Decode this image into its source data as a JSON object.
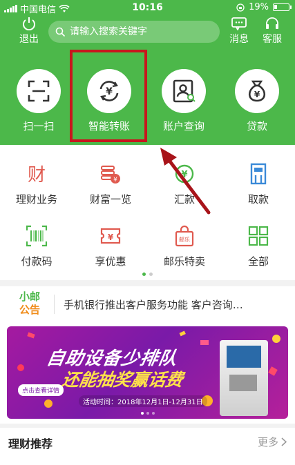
{
  "status_bar": {
    "carrier": "中国电信",
    "time": "10:16",
    "battery": "19%",
    "battery_level": 0.19
  },
  "header": {
    "logout_label": "退出",
    "search_placeholder": "请输入搜索关键字",
    "message_label": "消息",
    "service_label": "客服"
  },
  "quick_actions": [
    {
      "label": "扫一扫",
      "icon": "scan-icon"
    },
    {
      "label": "智能转账",
      "icon": "transfer-icon"
    },
    {
      "label": "账户查询",
      "icon": "account-query-icon"
    },
    {
      "label": "贷款",
      "icon": "loan-bag-icon"
    }
  ],
  "services": [
    {
      "label": "理财业务",
      "icon": "wealth-character-icon"
    },
    {
      "label": "财富一览",
      "icon": "coin-stack-icon"
    },
    {
      "label": "汇款",
      "icon": "remit-icon"
    },
    {
      "label": "取款",
      "icon": "atm-withdraw-icon"
    },
    {
      "label": "付款码",
      "icon": "barcode-icon"
    },
    {
      "label": "享优惠",
      "icon": "coupon-icon"
    },
    {
      "label": "邮乐特卖",
      "icon": "shopping-bag-icon"
    },
    {
      "label": "全部",
      "icon": "grid-icon"
    }
  ],
  "notice": {
    "tag_line1": "小邮",
    "tag_line2": "公告",
    "text": "手机银行推出客户服务功能 客户咨询…"
  },
  "banner": {
    "title_line1": "自助设备少排队",
    "title_line2": "还能抽奖赢话费",
    "button": "点击查看详情",
    "date": "活动时间：2018年12月1日-12月31日"
  },
  "recommend": {
    "title": "理财推荐",
    "more": "更多"
  },
  "colors": {
    "brand_green": "#4cb84a",
    "highlight_red": "#c8161d",
    "accent_orange": "#f08c1a"
  }
}
